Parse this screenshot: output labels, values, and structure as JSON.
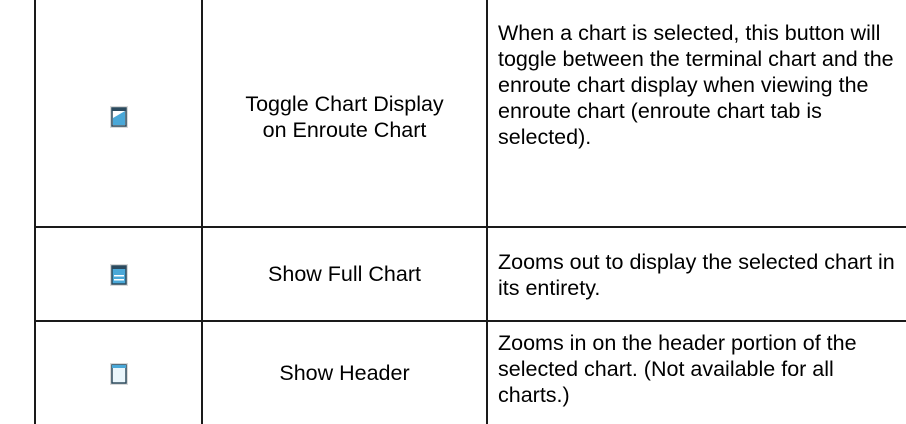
{
  "rows": [
    {
      "icon": "toggle-chart-display-icon",
      "name_lines": [
        "Toggle Chart Display",
        "on Enroute Chart"
      ],
      "description": "When a chart is selected, this button will toggle between the terminal chart and the enroute chart display when viewing the enroute chart (enroute chart tab is selected)."
    },
    {
      "icon": "show-full-chart-icon",
      "name_lines": [
        "Show Full Chart"
      ],
      "description": "Zooms out to display the selected chart in its entirety."
    },
    {
      "icon": "show-header-icon",
      "name_lines": [
        "Show Header"
      ],
      "description": "Zooms in on the header portion of the selected chart. (Not available for all charts.)"
    }
  ],
  "colors": {
    "border": "#1a1a1a",
    "icon_blue": "#4aa8d8",
    "icon_dark": "#2b4a5e"
  }
}
